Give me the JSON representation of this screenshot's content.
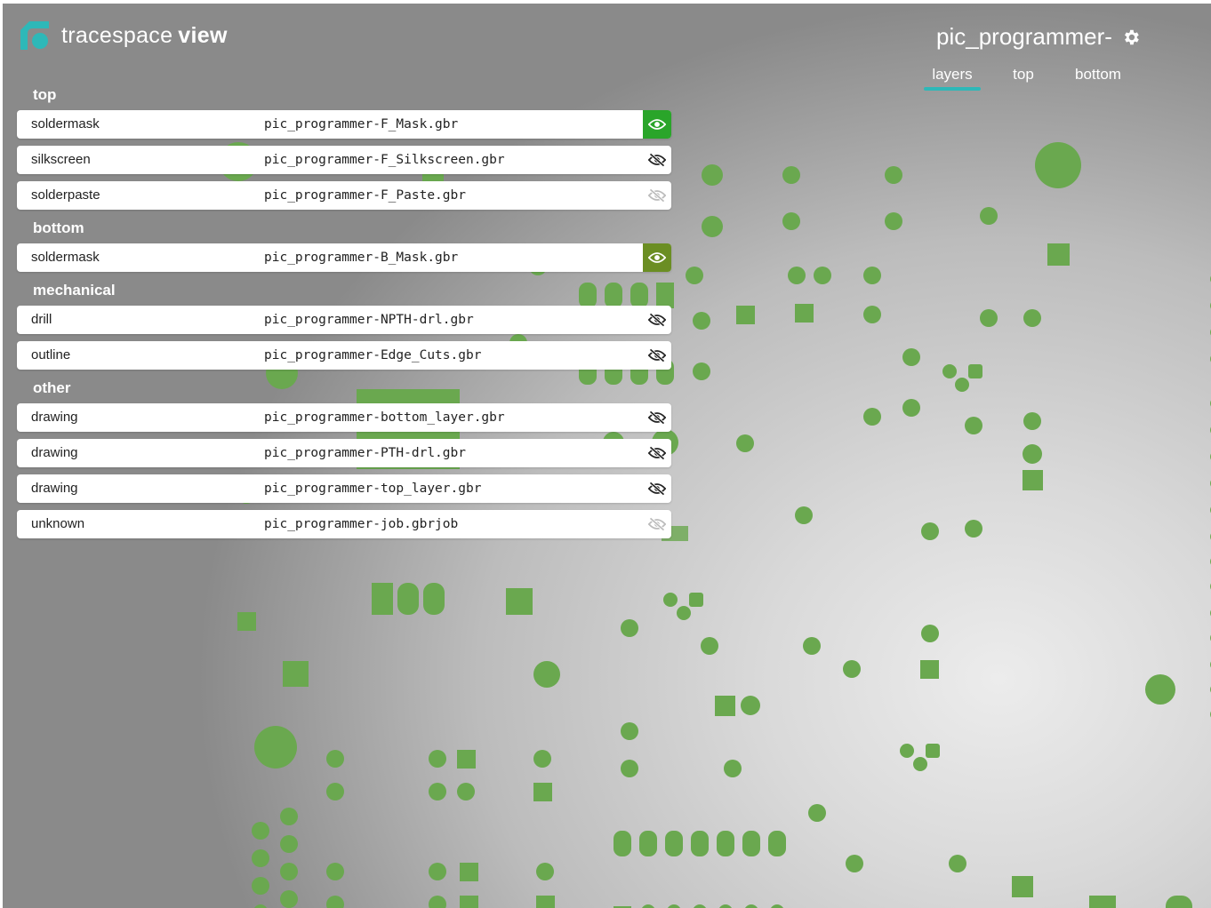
{
  "app": {
    "brand_name": "tracespace",
    "brand_suffix": "view",
    "accent": "#2eb8b8"
  },
  "header": {
    "board_title": "pic_programmer-",
    "settings_icon": "gear-icon"
  },
  "tabs": [
    {
      "label": "layers",
      "active": true
    },
    {
      "label": "top",
      "active": false
    },
    {
      "label": "bottom",
      "active": false
    }
  ],
  "layers": {
    "groups": [
      {
        "title": "top",
        "rows": [
          {
            "type": "soldermask",
            "file": "pic_programmer-F_Mask.gbr",
            "visible": true,
            "color": "#2aa52a"
          },
          {
            "type": "silkscreen",
            "file": "pic_programmer-F_Silkscreen.gbr",
            "visible": false
          },
          {
            "type": "solderpaste",
            "file": "pic_programmer-F_Paste.gbr",
            "visible": false,
            "muted": true
          }
        ]
      },
      {
        "title": "bottom",
        "rows": [
          {
            "type": "soldermask",
            "file": "pic_programmer-B_Mask.gbr",
            "visible": true,
            "color": "#6b8e23"
          }
        ]
      },
      {
        "title": "mechanical",
        "rows": [
          {
            "type": "drill",
            "file": "pic_programmer-NPTH-drl.gbr",
            "visible": false
          },
          {
            "type": "outline",
            "file": "pic_programmer-Edge_Cuts.gbr",
            "visible": false
          }
        ]
      },
      {
        "title": "other",
        "rows": [
          {
            "type": "drawing",
            "file": "pic_programmer-bottom_layer.gbr",
            "visible": false
          },
          {
            "type": "drawing",
            "file": "pic_programmer-PTH-drl.gbr",
            "visible": false
          },
          {
            "type": "drawing",
            "file": "pic_programmer-top_layer.gbr",
            "visible": false
          },
          {
            "type": "unknown",
            "file": "pic_programmer-job.gbrjob",
            "visible": false,
            "muted": true
          }
        ]
      }
    ]
  },
  "board": {
    "pad_color": "#6aa84f"
  }
}
